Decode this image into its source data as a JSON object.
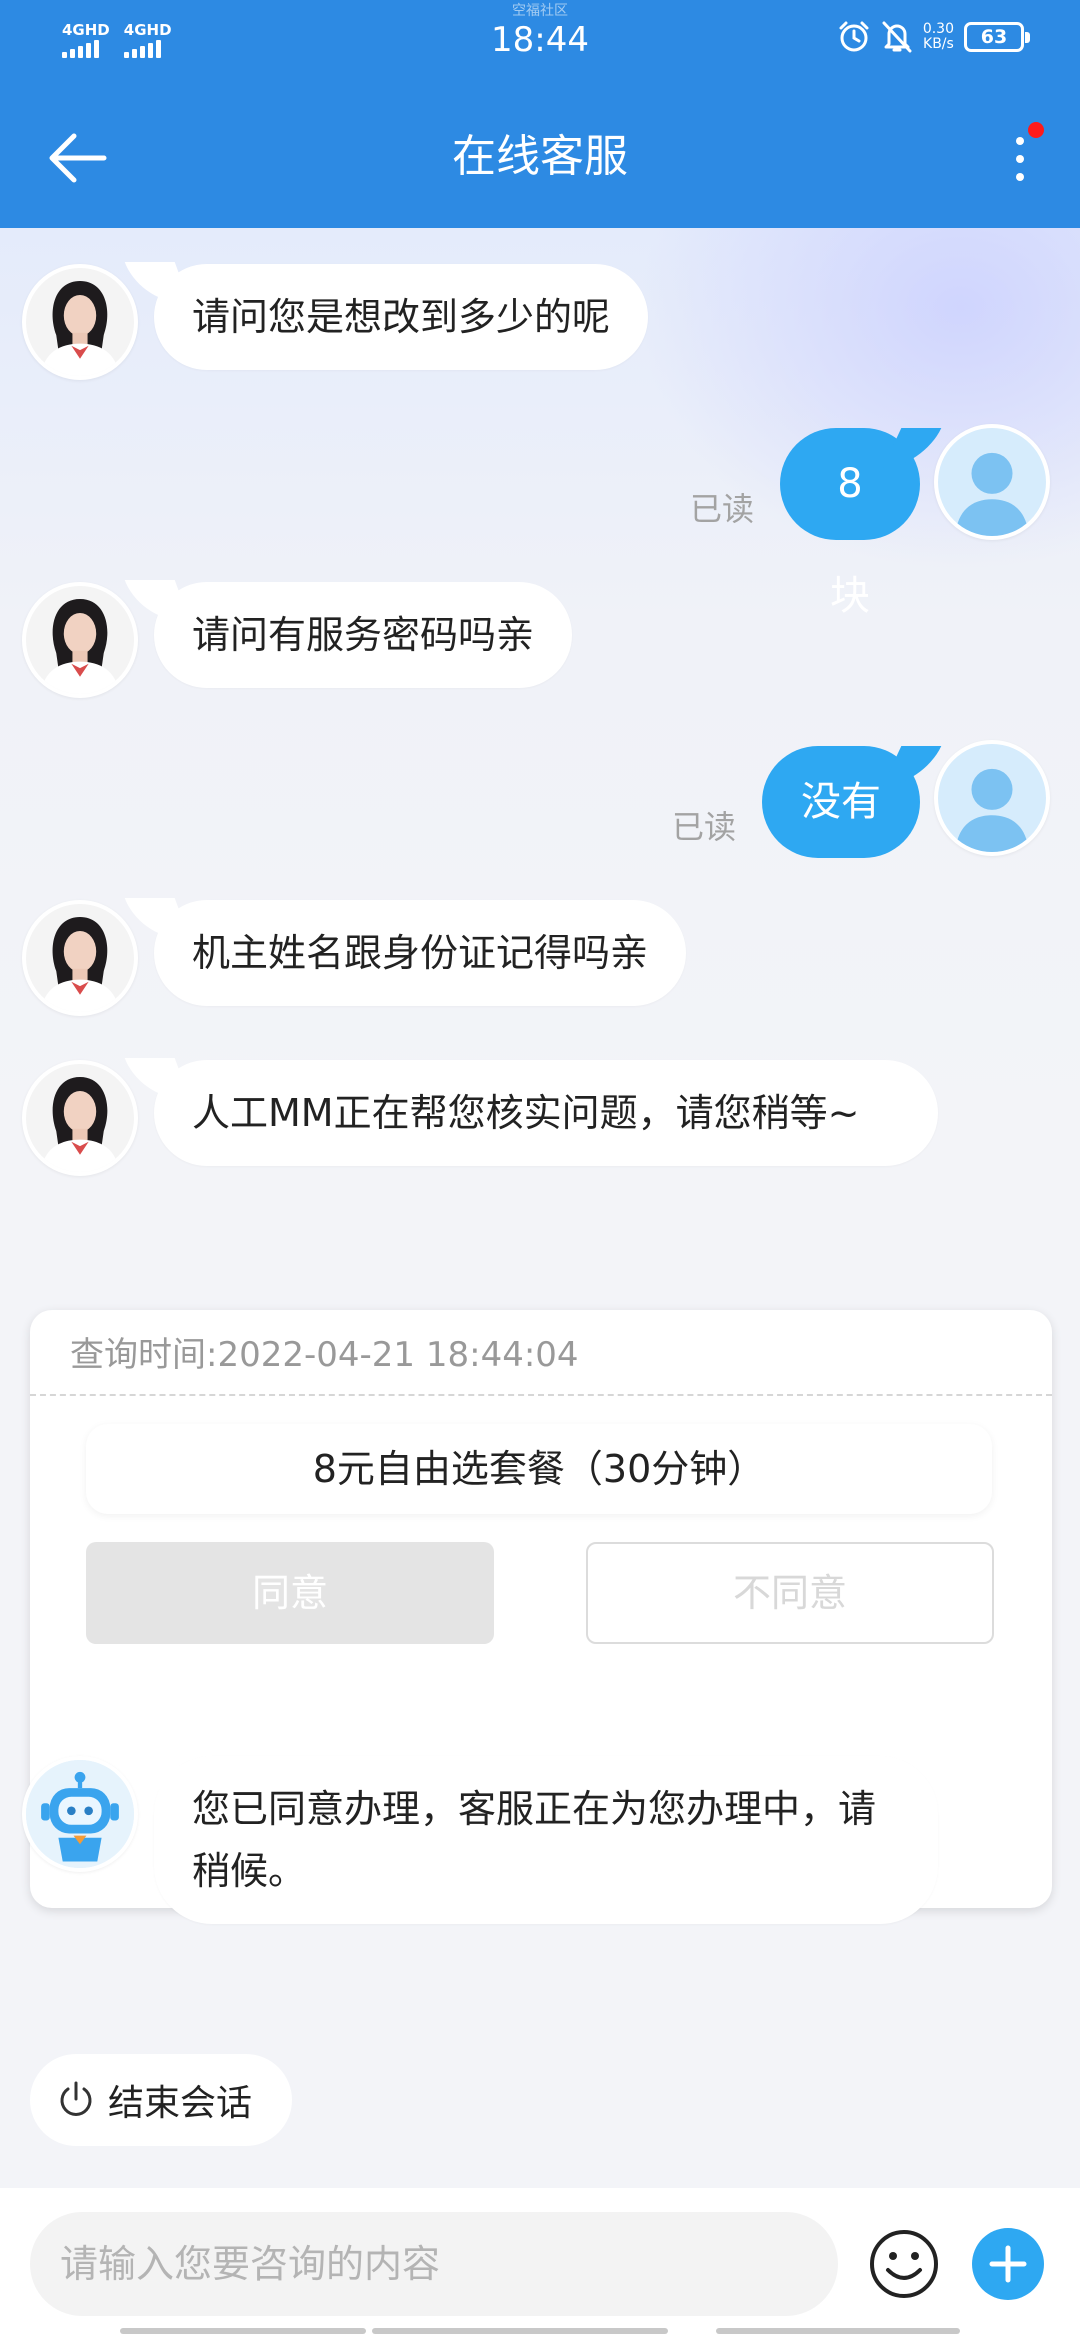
{
  "status_bar": {
    "network1": "4GHD",
    "network2": "4GHD",
    "brand": "空福社区",
    "time": "18:44",
    "speed_value": "0.30",
    "speed_unit": "KB/s",
    "battery": "63",
    "icons": [
      "alarm-icon",
      "mute-icon"
    ]
  },
  "header": {
    "title": "在线客服"
  },
  "messages": [
    {
      "from": "agent",
      "text": "请问您是想改到多少的呢"
    },
    {
      "from": "user",
      "text": "8块",
      "status": "已读"
    },
    {
      "from": "agent",
      "text": "请问有服务密码吗亲"
    },
    {
      "from": "user",
      "text": "没有",
      "status": "已读"
    },
    {
      "from": "agent",
      "text": "机主姓名跟身份证记得吗亲"
    },
    {
      "from": "agent",
      "text": "人工MM正在帮您核实问题，请您稍等~"
    },
    {
      "from": "bot",
      "text": "您已同意办理，客服正在为您办理中，请稍候。"
    }
  ],
  "card": {
    "query_time": "查询时间:2022-04-21 18:44:04",
    "package": "8元自由选套餐（30分钟）",
    "agree": "同意",
    "disagree": "不同意"
  },
  "end_session": "结束会话",
  "input": {
    "placeholder": "请输入您要咨询的内容"
  },
  "colors": {
    "header_blue": "#2d8ae3",
    "bubble_blue": "#2ea8f2",
    "notify_red": "#ff1a1a"
  }
}
